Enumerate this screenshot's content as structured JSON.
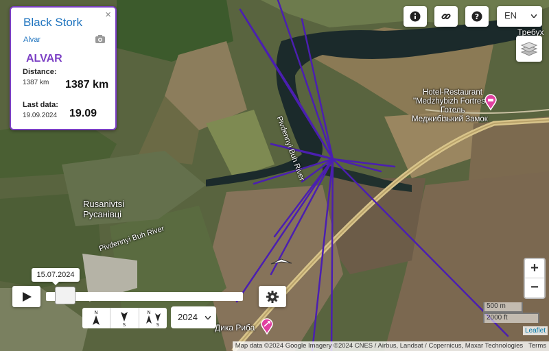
{
  "panel": {
    "title": "Black Stork",
    "subtitle": "Alvar",
    "bird_name": "ALVAR",
    "distance_label": "Distance:",
    "distance_small": "1387 km",
    "distance_big": "1387 km",
    "lastdata_label": "Last data:",
    "lastdata_small": "19.09.2024",
    "lastdata_big": "19.09",
    "close": "×"
  },
  "controls": {
    "language": "EN",
    "year": "2024",
    "date_tooltip": "15.07.2024",
    "zoom_in": "+",
    "zoom_out": "−",
    "icons": [
      "info-icon",
      "link-icon",
      "help-icon",
      "layers-icon",
      "play-icon",
      "gear-icon",
      "camera-icon"
    ]
  },
  "playback": {
    "position_fraction": 0.05
  },
  "direction_buttons": [
    {
      "top": "N",
      "bottom": "S"
    },
    {
      "top": "",
      "bottom": "S"
    },
    {
      "top": "N",
      "bottom": "S"
    }
  ],
  "map_labels": {
    "village_en": "Rusanivtsi",
    "village_uk": "Русанівці",
    "river1": "Pivdennyi Buh River",
    "river2": "Pivdennyi Buh River",
    "hotel_line1": "Hotel-Restaurant",
    "hotel_line2": "\"Medzhybizh Fortress\"",
    "hotel_line3": "Готель",
    "hotel_line4": "Меджибізький Замок",
    "poi": "Дика Риба",
    "top_right": "Требух"
  },
  "scale": {
    "metric": "500 m",
    "imperial": "2000 ft"
  },
  "attribution": {
    "leaflet": "Leaflet",
    "text": "Map data ©2024 Google Imagery ©2024 CNES / Airbus, Landsat / Copernicus, Maxar Technologies",
    "terms": "Terms"
  },
  "colors": {
    "track": "#4b1fb0",
    "panel_border": "#7b3fc4",
    "title": "#1e73be",
    "poi": "#e040a0"
  }
}
